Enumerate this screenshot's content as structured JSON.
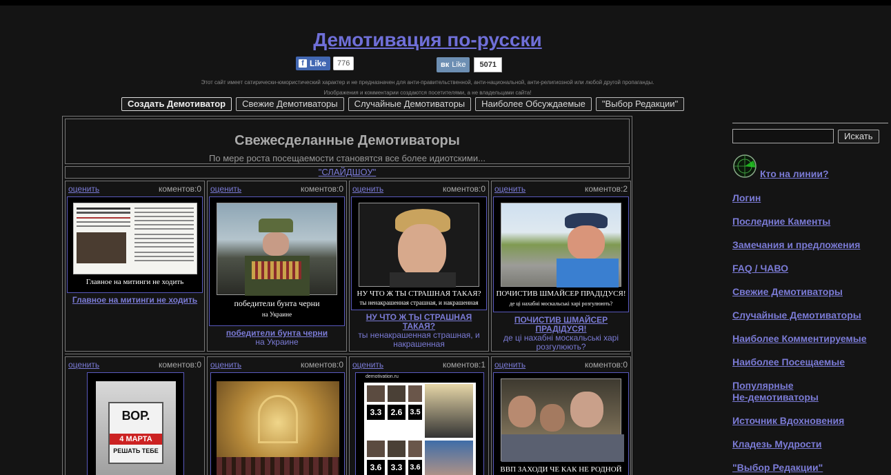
{
  "site": {
    "title": "Демотивация по-русски",
    "disclaimer_1": "Этот сайт имеет сатирически-юмористический характер и не предназначен для анти-правительственной, анти-национальной, анти-религиозной или любой другой пропаганды.",
    "disclaimer_2": "Изображения и комментарии создаются посетителями, а не владельцами сайта!"
  },
  "social": {
    "fb_label": "Like",
    "fb_count": "776",
    "vk_label": "Like",
    "vk_count": "5071"
  },
  "nav": [
    "Создать Демотиватор",
    "Свежие Демотиваторы",
    "Случайные Демотиваторы",
    "Наиболее Обсуждаемые",
    "\"Выбор Редакции\""
  ],
  "main": {
    "heading": "Свежесделанные Демотиваторы",
    "subheading": "По мере роста посещаемости становятся все более идиотскими...",
    "slideshow": "\"СЛАЙДШОУ\""
  },
  "cells": [
    {
      "rate": "оценить",
      "comments": "коментов:0",
      "caption": "Главное на митинги не ходить",
      "subcaption": "",
      "title": "Главное на митинги не ходить",
      "subtitle": ""
    },
    {
      "rate": "оценить",
      "comments": "коментов:0",
      "caption": "победители бунта черни",
      "subcaption": "на Украине",
      "title": "победители бунта черни",
      "subtitle": "на Украине"
    },
    {
      "rate": "оценить",
      "comments": "коментов:0",
      "caption": "НУ ЧТО Ж ТЫ СТРАШНАЯ ТАКАЯ?",
      "subcaption": "ты ненакрашенная страшная, и накрашенная",
      "title": "НУ ЧТО Ж ТЫ СТРАШНАЯ ТАКАЯ?",
      "subtitle": "ты ненакрашенная страшная, и накрашенная"
    },
    {
      "rate": "оценить",
      "comments": "коментов:2",
      "caption": "ПОЧИСТИВ ШМАЙСЕР ПРАДІДУСЯ!",
      "subcaption": "де ці нахабні москальські харі розгулюють?",
      "title": "ПОЧИСТИВ ШМАЙСЕР ПРАДІДУСЯ!",
      "subtitle": "де ці нахабні москальські харі розгулюють?"
    },
    {
      "rate": "оценить",
      "comments": "коментов:0",
      "poster_1": "ВОР.",
      "poster_2": "4 МАРТА",
      "poster_3": "РЕШАТЬ ТЕБЕ"
    },
    {
      "rate": "оценить",
      "comments": "коментов:0"
    },
    {
      "rate": "оценить",
      "comments": "коментов:1",
      "header": "demotivation.ru",
      "grades": [
        "3.3",
        "2.6",
        "3.5",
        "3.6",
        "3.3",
        "3.6"
      ]
    },
    {
      "rate": "оценить",
      "comments": "коментов:0",
      "caption": "ВВП ЗАХОДИ ЧЕ КАК НЕ РОДНОЙ"
    }
  ],
  "sidebar": {
    "search_button": "Искать",
    "online": "Кто на линии?",
    "links": [
      "Логин",
      "Последние Каменты",
      "Замечания и предложения",
      "FAQ / ЧАВО",
      "Свежие Демотиваторы",
      "Случайные Демотиваторы",
      "Наиболее Комментируемые",
      "Наиболее Посещаемые",
      "Популярные",
      "Не-демотиваторы",
      "Источник Вдохновения",
      "Кладезь Мудрости",
      "\"Выбор Редакции\""
    ]
  },
  "colors": {
    "background": "#141414",
    "link": "#7b7bd6",
    "title_link": "#6f6fd8",
    "fb": "#4267b2",
    "vk": "#6d8fb3"
  }
}
